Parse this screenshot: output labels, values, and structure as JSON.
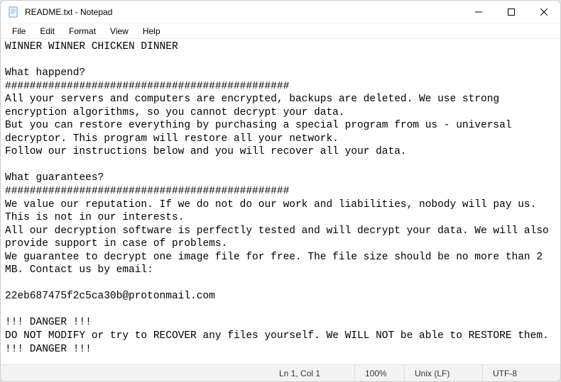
{
  "window": {
    "title": "README.txt - Notepad"
  },
  "menu": {
    "file": "File",
    "edit": "Edit",
    "format": "Format",
    "view": "View",
    "help": "Help"
  },
  "content": "WINNER WINNER CHICKEN DINNER\n\nWhat happend?\n##############################################\nAll your servers and computers are encrypted, backups are deleted. We use strong encryption algorithms, so you cannot decrypt your data.\nBut you can restore everything by purchasing a special program from us - universal decryptor. This program will restore all your network.\nFollow our instructions below and you will recover all your data.\n\nWhat guarantees?\n##############################################\nWe value our reputation. If we do not do our work and liabilities, nobody will pay us. This is not in our interests.\nAll our decryption software is perfectly tested and will decrypt your data. We will also provide support in case of problems.\nWe guarantee to decrypt one image file for free. The file size should be no more than 2 MB. Contact us by email:\n\n22eb687475f2c5ca30b@protonmail.com\n\n!!! DANGER !!!\nDO NOT MODIFY or try to RECOVER any files yourself. We WILL NOT be able to RESTORE them.\n!!! DANGER !!!",
  "statusbar": {
    "position": "Ln 1, Col 1",
    "zoom": "100%",
    "line_ending": "Unix (LF)",
    "encoding": "UTF-8"
  }
}
